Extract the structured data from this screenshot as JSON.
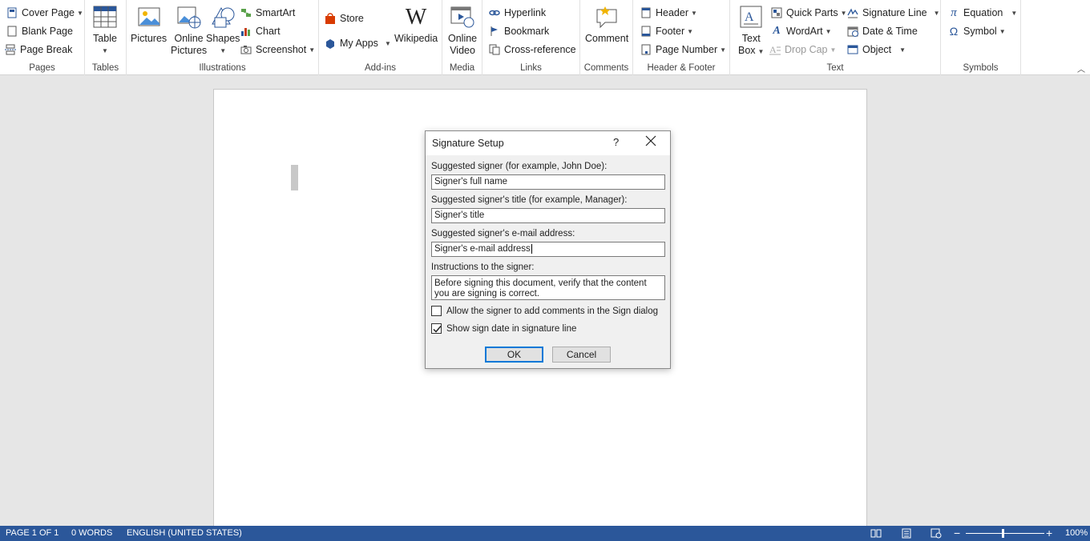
{
  "ribbon": {
    "pages": {
      "label": "Pages",
      "cover_page": "Cover Page",
      "blank_page": "Blank Page",
      "page_break": "Page Break"
    },
    "tables": {
      "label": "Tables",
      "table": "Table"
    },
    "illustrations": {
      "label": "Illustrations",
      "pictures": "Pictures",
      "online_pictures_1": "Online",
      "online_pictures_2": "Pictures",
      "shapes": "Shapes",
      "smartart": "SmartArt",
      "chart": "Chart",
      "screenshot": "Screenshot"
    },
    "addins": {
      "label": "Add-ins",
      "store": "Store",
      "my_apps": "My Apps",
      "wikipedia": "Wikipedia",
      "wikipedia_glyph": "W"
    },
    "media": {
      "label": "Media",
      "online_video_1": "Online",
      "online_video_2": "Video"
    },
    "links": {
      "label": "Links",
      "hyperlink": "Hyperlink",
      "bookmark": "Bookmark",
      "cross_reference": "Cross-reference"
    },
    "comments": {
      "label": "Comments",
      "comment": "Comment"
    },
    "header_footer": {
      "label": "Header & Footer",
      "header": "Header",
      "footer": "Footer",
      "page_number": "Page Number"
    },
    "text": {
      "label": "Text",
      "text_box_1": "Text",
      "text_box_2": "Box",
      "quick_parts": "Quick Parts",
      "wordart": "WordArt",
      "drop_cap": "Drop Cap",
      "signature_line": "Signature Line",
      "date_time": "Date & Time",
      "object": "Object"
    },
    "symbols": {
      "label": "Symbols",
      "equation": "Equation",
      "symbol": "Symbol",
      "pi_glyph": "π",
      "omega_glyph": "Ω"
    }
  },
  "dialog": {
    "title": "Signature Setup",
    "help": "?",
    "signer_label": "Suggested signer (for example, John Doe):",
    "signer_value": "Signer's full name",
    "title_label": "Suggested signer's title (for example, Manager):",
    "title_value": "Signer's title",
    "email_label": "Suggested signer's e-mail address:",
    "email_value": "Signer's e-mail address",
    "instructions_label": "Instructions to the signer:",
    "instructions_value": "Before signing this document, verify that the content you are signing is correct.",
    "allow_comments_label": "Allow the signer to add comments in the Sign dialog",
    "allow_comments_checked": false,
    "show_date_label": "Show sign date in signature line",
    "show_date_checked": true,
    "ok": "OK",
    "cancel": "Cancel"
  },
  "status": {
    "page": "PAGE 1 OF 1",
    "words": "0 WORDS",
    "language": "ENGLISH (UNITED STATES)",
    "zoom_minus": "−",
    "zoom_plus": "+",
    "zoom": "100%"
  },
  "colors": {
    "accent": "#2b579a",
    "focus": "#0078d7"
  }
}
